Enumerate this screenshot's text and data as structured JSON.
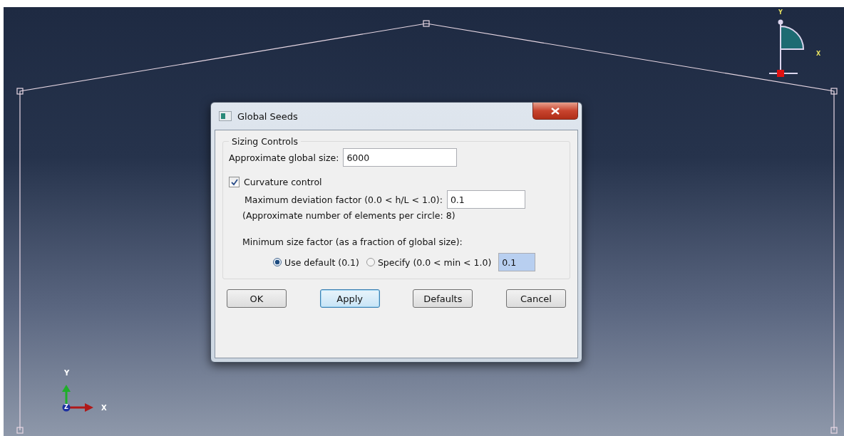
{
  "viewport": {
    "glyph_labels": [
      "Y",
      "X"
    ],
    "triad_labels": [
      "Y",
      "Z",
      "X"
    ]
  },
  "dialog": {
    "title": "Global Seeds",
    "group_title": "Sizing Controls",
    "global_size": {
      "label": "Approximate global size:",
      "value": "6000"
    },
    "curvature": {
      "label": "Curvature control",
      "checked": true
    },
    "deviation": {
      "label": "Maximum deviation factor (0.0 < h/L < 1.0):",
      "value": "0.1"
    },
    "note": "(Approximate number of elements per circle: 8)",
    "min_size": {
      "label": "Minimum size factor (as a fraction of global size):",
      "value": "0.1",
      "options": [
        {
          "label": "Use default (0.1)",
          "selected": true
        },
        {
          "label": "Specify (0.0 < min < 1.0)",
          "selected": false
        }
      ]
    },
    "buttons": [
      {
        "label": "OK",
        "focused": false
      },
      {
        "label": "Apply",
        "focused": true
      },
      {
        "label": "Defaults",
        "focused": false
      },
      {
        "label": "Cancel",
        "focused": false
      }
    ]
  }
}
